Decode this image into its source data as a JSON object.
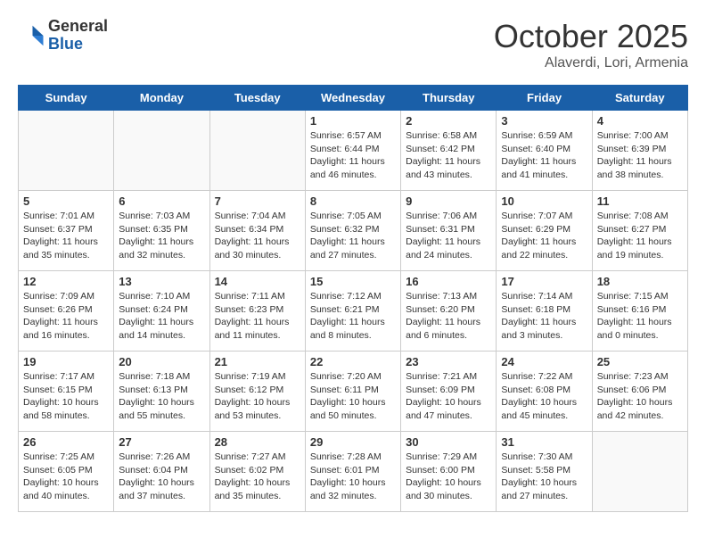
{
  "header": {
    "logo_general": "General",
    "logo_blue": "Blue",
    "month": "October 2025",
    "location": "Alaverdi, Lori, Armenia"
  },
  "days_of_week": [
    "Sunday",
    "Monday",
    "Tuesday",
    "Wednesday",
    "Thursday",
    "Friday",
    "Saturday"
  ],
  "weeks": [
    [
      {
        "day": "",
        "info": ""
      },
      {
        "day": "",
        "info": ""
      },
      {
        "day": "",
        "info": ""
      },
      {
        "day": "1",
        "info": "Sunrise: 6:57 AM\nSunset: 6:44 PM\nDaylight: 11 hours\nand 46 minutes."
      },
      {
        "day": "2",
        "info": "Sunrise: 6:58 AM\nSunset: 6:42 PM\nDaylight: 11 hours\nand 43 minutes."
      },
      {
        "day": "3",
        "info": "Sunrise: 6:59 AM\nSunset: 6:40 PM\nDaylight: 11 hours\nand 41 minutes."
      },
      {
        "day": "4",
        "info": "Sunrise: 7:00 AM\nSunset: 6:39 PM\nDaylight: 11 hours\nand 38 minutes."
      }
    ],
    [
      {
        "day": "5",
        "info": "Sunrise: 7:01 AM\nSunset: 6:37 PM\nDaylight: 11 hours\nand 35 minutes."
      },
      {
        "day": "6",
        "info": "Sunrise: 7:03 AM\nSunset: 6:35 PM\nDaylight: 11 hours\nand 32 minutes."
      },
      {
        "day": "7",
        "info": "Sunrise: 7:04 AM\nSunset: 6:34 PM\nDaylight: 11 hours\nand 30 minutes."
      },
      {
        "day": "8",
        "info": "Sunrise: 7:05 AM\nSunset: 6:32 PM\nDaylight: 11 hours\nand 27 minutes."
      },
      {
        "day": "9",
        "info": "Sunrise: 7:06 AM\nSunset: 6:31 PM\nDaylight: 11 hours\nand 24 minutes."
      },
      {
        "day": "10",
        "info": "Sunrise: 7:07 AM\nSunset: 6:29 PM\nDaylight: 11 hours\nand 22 minutes."
      },
      {
        "day": "11",
        "info": "Sunrise: 7:08 AM\nSunset: 6:27 PM\nDaylight: 11 hours\nand 19 minutes."
      }
    ],
    [
      {
        "day": "12",
        "info": "Sunrise: 7:09 AM\nSunset: 6:26 PM\nDaylight: 11 hours\nand 16 minutes."
      },
      {
        "day": "13",
        "info": "Sunrise: 7:10 AM\nSunset: 6:24 PM\nDaylight: 11 hours\nand 14 minutes."
      },
      {
        "day": "14",
        "info": "Sunrise: 7:11 AM\nSunset: 6:23 PM\nDaylight: 11 hours\nand 11 minutes."
      },
      {
        "day": "15",
        "info": "Sunrise: 7:12 AM\nSunset: 6:21 PM\nDaylight: 11 hours\nand 8 minutes."
      },
      {
        "day": "16",
        "info": "Sunrise: 7:13 AM\nSunset: 6:20 PM\nDaylight: 11 hours\nand 6 minutes."
      },
      {
        "day": "17",
        "info": "Sunrise: 7:14 AM\nSunset: 6:18 PM\nDaylight: 11 hours\nand 3 minutes."
      },
      {
        "day": "18",
        "info": "Sunrise: 7:15 AM\nSunset: 6:16 PM\nDaylight: 11 hours\nand 0 minutes."
      }
    ],
    [
      {
        "day": "19",
        "info": "Sunrise: 7:17 AM\nSunset: 6:15 PM\nDaylight: 10 hours\nand 58 minutes."
      },
      {
        "day": "20",
        "info": "Sunrise: 7:18 AM\nSunset: 6:13 PM\nDaylight: 10 hours\nand 55 minutes."
      },
      {
        "day": "21",
        "info": "Sunrise: 7:19 AM\nSunset: 6:12 PM\nDaylight: 10 hours\nand 53 minutes."
      },
      {
        "day": "22",
        "info": "Sunrise: 7:20 AM\nSunset: 6:11 PM\nDaylight: 10 hours\nand 50 minutes."
      },
      {
        "day": "23",
        "info": "Sunrise: 7:21 AM\nSunset: 6:09 PM\nDaylight: 10 hours\nand 47 minutes."
      },
      {
        "day": "24",
        "info": "Sunrise: 7:22 AM\nSunset: 6:08 PM\nDaylight: 10 hours\nand 45 minutes."
      },
      {
        "day": "25",
        "info": "Sunrise: 7:23 AM\nSunset: 6:06 PM\nDaylight: 10 hours\nand 42 minutes."
      }
    ],
    [
      {
        "day": "26",
        "info": "Sunrise: 7:25 AM\nSunset: 6:05 PM\nDaylight: 10 hours\nand 40 minutes."
      },
      {
        "day": "27",
        "info": "Sunrise: 7:26 AM\nSunset: 6:04 PM\nDaylight: 10 hours\nand 37 minutes."
      },
      {
        "day": "28",
        "info": "Sunrise: 7:27 AM\nSunset: 6:02 PM\nDaylight: 10 hours\nand 35 minutes."
      },
      {
        "day": "29",
        "info": "Sunrise: 7:28 AM\nSunset: 6:01 PM\nDaylight: 10 hours\nand 32 minutes."
      },
      {
        "day": "30",
        "info": "Sunrise: 7:29 AM\nSunset: 6:00 PM\nDaylight: 10 hours\nand 30 minutes."
      },
      {
        "day": "31",
        "info": "Sunrise: 7:30 AM\nSunset: 5:58 PM\nDaylight: 10 hours\nand 27 minutes."
      },
      {
        "day": "",
        "info": ""
      }
    ]
  ]
}
